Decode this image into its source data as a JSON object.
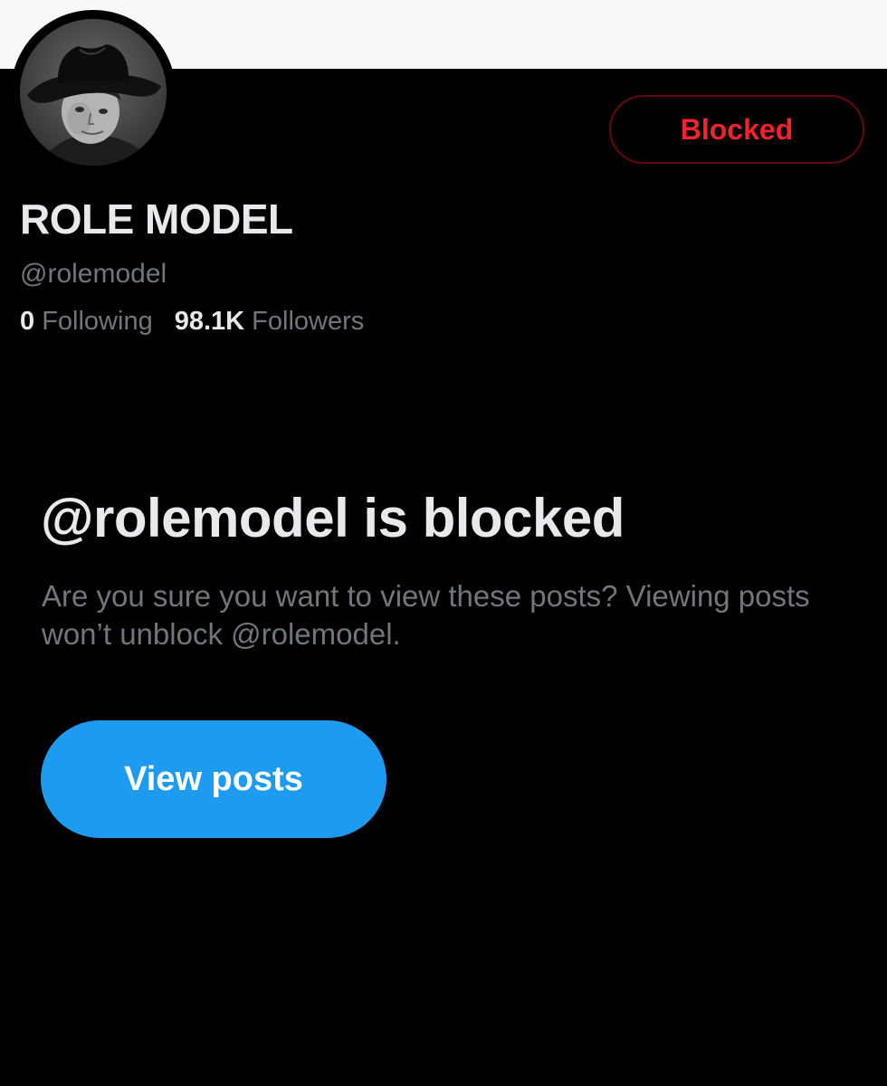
{
  "profile": {
    "display_name": "ROLE MODEL",
    "handle": "@rolemodel",
    "avatar_icon": "profile-photo-cowboy-hat",
    "blocked_button_label": "Blocked",
    "stats": {
      "following_count": "0",
      "following_label": "Following",
      "followers_count": "98.1K",
      "followers_label": "Followers"
    }
  },
  "blocked_notice": {
    "title": "@rolemodel is blocked",
    "description": "Are you sure you want to view these posts? Viewing posts won’t unblock @rolemodel.",
    "view_posts_label": "View posts"
  },
  "colors": {
    "background": "#000000",
    "banner": "#f8f8f8",
    "blocked_red": "#f4212e",
    "blocked_border": "#67070f",
    "accent_blue": "#1d9bf0",
    "primary_text": "#e7e9ea",
    "secondary_text": "#71767b"
  }
}
